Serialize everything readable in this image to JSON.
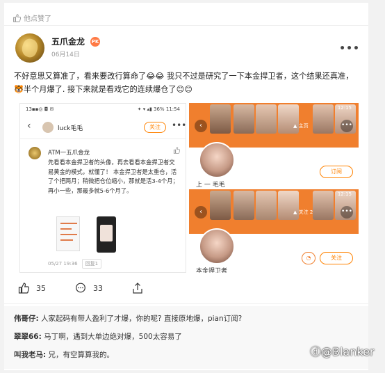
{
  "liked_bar": {
    "text": "他点赞了"
  },
  "post": {
    "username": "五爪金龙",
    "pk_badge": "PK",
    "date": "06月14日",
    "more": "•••",
    "text": "不好意思又算准了，看来要改行算命了😂😂 我只不过是研究了一下本金捍卫者，这个结果还真准，🐯半个月爆了. 接下来就是看戏它的连续爆仓了😊😊"
  },
  "screenshot_left": {
    "status_left": "13▪▪◎ ◘ ✉",
    "status_right": "✦ ▾ ▴▮ 36% 11:54",
    "back": "‹",
    "nav_name": "luck毛毛",
    "follow": "关注",
    "more": "•••",
    "comment_name": "ATM一五爪金龙",
    "comment_text": "先看看本金捍卫者的头像，再去看看本金捍卫者交易黄金的模式，就懂了！ 本金捍卫者是太重仓，活了个把两月；稍微把仓位缩小，那就是活3-4个月；再小一些，那最多就5-6个月了。",
    "comment_date": "05/27 19:36",
    "reply_label": "回复1"
  },
  "screenshot_right": {
    "status_time": "12:15",
    "tag": "▲ 主页",
    "tag2": "▲ 关注 2",
    "subscribe": "订阅",
    "follow": "关注",
    "name_cut_top": "上 一 毛毛",
    "name_cut_bottom": "本金捍卫者"
  },
  "actions": {
    "likes": "35",
    "comments": "33"
  },
  "comments": [
    {
      "user": "伟哥仔:",
      "text": " 人家起码有带人盈利了才爆，你的呢? 直接原地爆，pian订阅?"
    },
    {
      "user": "翠翠66:",
      "text": " 马丁啊，遇到大单边绝对爆，500太容易了"
    },
    {
      "user": "叫我老马:",
      "text": " 兄，有空算算我的。"
    }
  ],
  "watermark": "ⓓ@Blanker",
  "colors": {
    "accent": "#ff8200",
    "banner": "#f07f2e"
  }
}
